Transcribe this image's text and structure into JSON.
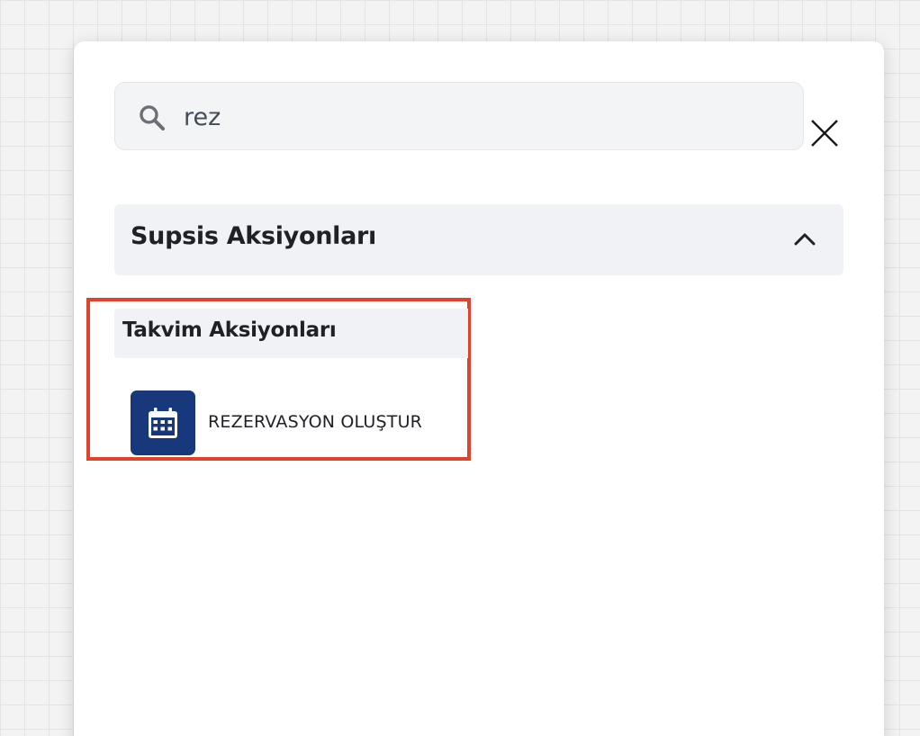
{
  "search": {
    "value": "rez",
    "icon": "search-icon"
  },
  "close": {
    "label": "X"
  },
  "section": {
    "title": "Supsis Aksiyonları",
    "expanded": true,
    "toggle_icon": "chevron-up-icon"
  },
  "subgroup": {
    "title": "Takvim Aksiyonları",
    "highlight_color": "#e0432b"
  },
  "actions": [
    {
      "label": "REZERVASYON OLUŞTUR",
      "icon": "calendar-icon",
      "icon_bg": "#17397b"
    }
  ],
  "colors": {
    "accent": "#17397b",
    "highlight": "#e0432b",
    "section_bg": "#f1f2f5"
  }
}
